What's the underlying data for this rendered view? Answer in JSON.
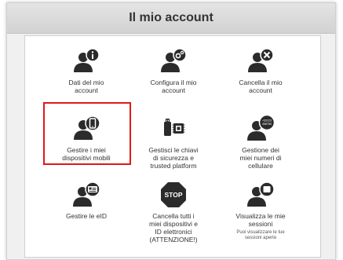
{
  "window": {
    "title": "Il mio account"
  },
  "items": [
    {
      "label": "Dati del mio\naccount",
      "icon": "user-info-icon"
    },
    {
      "label": "Configura il mio\naccount",
      "icon": "user-gear-icon"
    },
    {
      "label": "Cancella il mio\naccount",
      "icon": "user-delete-icon"
    },
    {
      "label": "Gestire i miei\ndispositivi mobili",
      "icon": "user-mobile-icon",
      "highlighted": true
    },
    {
      "label": "Gestisci le chiavi\ndi sicurezza e\ntrusted platform",
      "icon": "security-key-icon"
    },
    {
      "label": "Gestione dei\nmiei numeri di\ncellulare",
      "icon": "user-phone-number-icon",
      "badge": "+33123\n456789"
    },
    {
      "label": "Gestire le eID",
      "icon": "user-eid-card-icon"
    },
    {
      "label": "Cancella tutti i\nmiei dispositivi e\nID elettronici\n(ATTENZIONE!)",
      "icon": "stop-sign-icon",
      "badge": "STOP"
    },
    {
      "label": "Visualizza le mie\nsessioni",
      "icon": "user-sessions-icon",
      "note": "Puoi visualizzare le tue\nsessioni aperte"
    }
  ],
  "colors": {
    "icon": "#2b2b2b",
    "highlight": "#e01818",
    "header": "#d8d8d8"
  }
}
